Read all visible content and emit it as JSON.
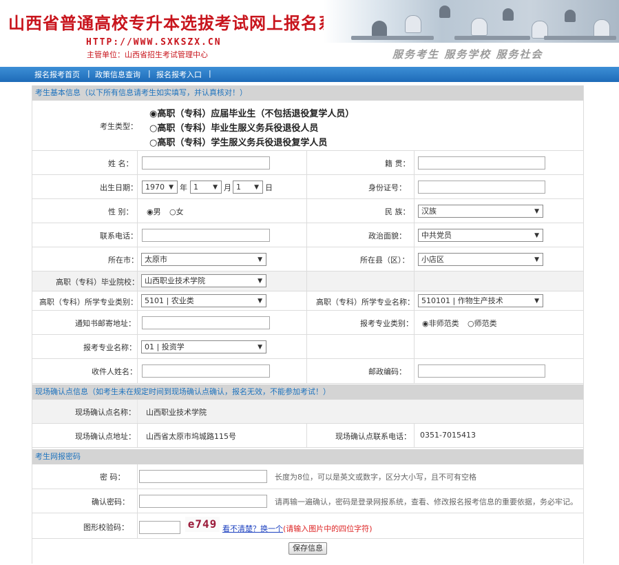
{
  "header": {
    "title": "山西省普通高校专升本选拔考试网上报名系统",
    "url": "HTTP://WWW.SXKSZX.CN",
    "organizer": "主管单位：山西省招生考试管理中心",
    "slogan": "服务考生  服务学校  服务社会"
  },
  "nav": {
    "items": [
      "报名报考首页",
      "政策信息查询",
      "报名报考入口"
    ]
  },
  "section_basic": {
    "title": "考生基本信息（以下所有信息请考生如实填写，并认真核对！）"
  },
  "exam_type": {
    "label": "考生类型：",
    "options": [
      "高职（专科）应届毕业生（不包括退役复学人员）",
      "高职（专科）毕业生服义务兵役退役人员",
      "高职（专科）学生服义务兵役退役复学人员"
    ],
    "selected_index": 0,
    "selected_mark": "◉",
    "unselected_mark": "○"
  },
  "fields": {
    "name": {
      "label": "姓  名：",
      "value": ""
    },
    "native_place": {
      "label": "籍  贯：",
      "value": ""
    },
    "birth": {
      "label": "出生日期：",
      "year": "1970",
      "year_unit": "年",
      "month": "1",
      "month_unit": "月",
      "day": "1",
      "day_unit": "日"
    },
    "id_number": {
      "label": "身份证号：",
      "value": ""
    },
    "gender": {
      "label": "性  别：",
      "options": [
        "男",
        "女"
      ],
      "selected_index": 0
    },
    "ethnicity": {
      "label": "民  族：",
      "value": "汉族"
    },
    "phone": {
      "label": "联系电话：",
      "value": ""
    },
    "political_status": {
      "label": "政治面貌：",
      "value": "中共党员"
    },
    "city": {
      "label": "所在市：",
      "value": "太原市"
    },
    "county": {
      "label": "所在县（区）：",
      "value": "小店区"
    },
    "college": {
      "label": "高职（专科）毕业院校：",
      "value": "山西职业技术学院"
    },
    "major_category": {
      "label": "高职（专科）所学专业类别：",
      "value": "5101 | 农业类"
    },
    "major_name": {
      "label": "高职（专科）所学专业名称：",
      "value": "510101 | 作物生产技术"
    },
    "mail_address": {
      "label": "通知书邮寄地址：",
      "value": ""
    },
    "apply_major_type": {
      "label": "报考专业类别：",
      "options": [
        "非师范类",
        "师范类"
      ],
      "selected_index": 0
    },
    "apply_major": {
      "label": "报考专业名称：",
      "value": "01 | 投资学"
    },
    "recipient": {
      "label": "收件人姓名：",
      "value": ""
    },
    "postcode": {
      "label": "邮政编码：",
      "value": ""
    }
  },
  "section_confirm": {
    "title": "现场确认点信息（如考生未在规定时间到现场确认点确认，报名无效，不能参加考试！）"
  },
  "confirm": {
    "site_name_label": "现场确认点名称：",
    "site_name": "山西职业技术学院",
    "site_address_label": "现场确认点地址：",
    "site_address": "山西省太原市坞城路115号",
    "site_phone_label": "现场确认点联系电话：",
    "site_phone": "0351-7015413"
  },
  "section_password": {
    "title": "考生网报密码"
  },
  "password": {
    "label": "密  码：",
    "hint": "长度为8位，可以是英文或数字，区分大小写，且不可有空格",
    "confirm_label": "确认密码：",
    "confirm_hint": "请再输一遍确认，密码是登录网报系统，查看、修改报名报考信息的重要依据，务必牢记。"
  },
  "captcha": {
    "label": "图形校验码：",
    "image_text": "e749",
    "refresh_text": "看不清楚？换一个",
    "hint": "(请输入图片中的四位字符)"
  },
  "save_button": "保存信息"
}
